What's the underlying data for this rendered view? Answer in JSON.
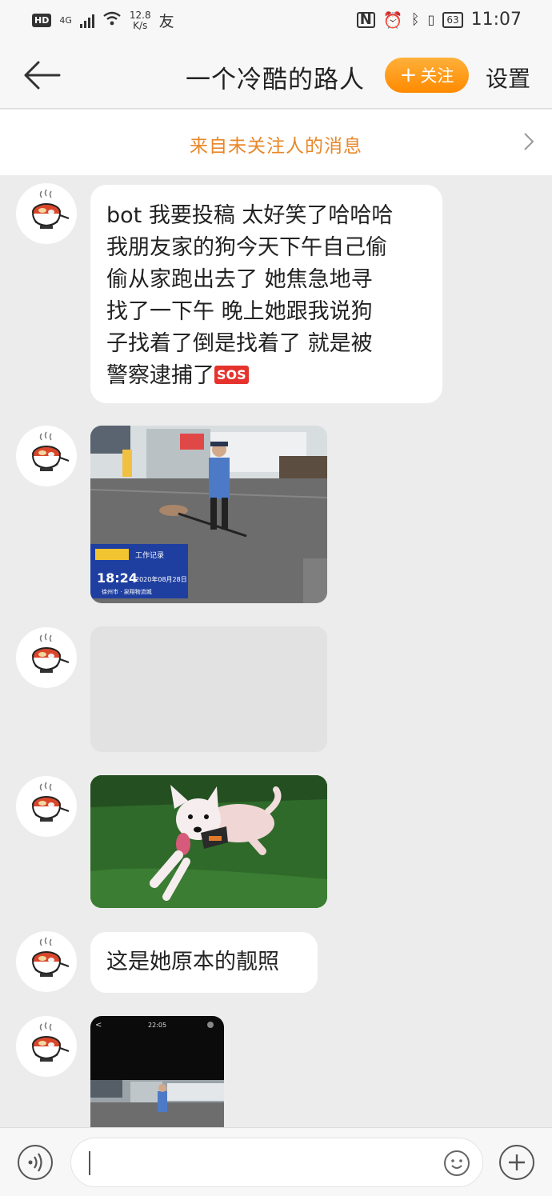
{
  "status_bar": {
    "network_badge": "HD",
    "network_type": "4G",
    "net_speed_value": "12.8",
    "net_speed_unit": "K/s",
    "extra_glyph": "友",
    "battery_level": "63",
    "time": "11:07"
  },
  "header": {
    "title": "一个冷酷的路人",
    "follow_label": "关注",
    "settings_label": "设置"
  },
  "notice": {
    "text": "来自未关注人的消息"
  },
  "messages": [
    {
      "type": "text",
      "text": "bot 我要投稿 太好笑了哈哈哈\n我朋友家的狗今天下午自己偷\n偷从家跑出去了 她焦急地寻\n找了一下午 晚上她跟我说狗\n子找着了倒是找着了 就是被\n警察逮捕了",
      "emoji": "SOS"
    },
    {
      "type": "image",
      "image_label": "工作记录",
      "image_time": "18:24",
      "image_date": "2020年08月28日",
      "image_location": "徐州市 · 泉翔物流城"
    },
    {
      "type": "image-loading"
    },
    {
      "type": "image",
      "description": "white dog lying on grass wearing harness"
    },
    {
      "type": "text",
      "text": "这是她原本的靓照"
    },
    {
      "type": "image",
      "image_time": "22:05"
    }
  ]
}
